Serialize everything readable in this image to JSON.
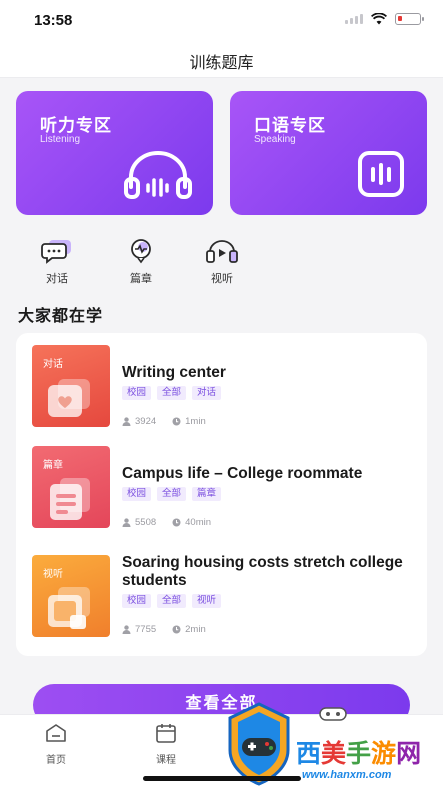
{
  "status_bar": {
    "time": "13:58"
  },
  "nav": {
    "title": "训练题库"
  },
  "zones": [
    {
      "title": "听力专区",
      "subtitle": "Listening",
      "icon": "headphones-icon"
    },
    {
      "title": "口语专区",
      "subtitle": "Speaking",
      "icon": "voice-wave-icon"
    }
  ],
  "quick_entries": [
    {
      "label": "对话",
      "icon": "dialogue-icon"
    },
    {
      "label": "篇章",
      "icon": "passage-icon"
    },
    {
      "label": "视听",
      "icon": "audiovisual-icon"
    }
  ],
  "section": {
    "title": "大家都在学"
  },
  "courses": [
    {
      "thumb_tag": "对话",
      "title": "Writing center",
      "tags": [
        "校园",
        "全部",
        "对话"
      ],
      "learners": "3924",
      "duration": "1min"
    },
    {
      "thumb_tag": "篇章",
      "title": "Campus life – College roommate",
      "tags": [
        "校园",
        "全部",
        "篇章"
      ],
      "learners": "5508",
      "duration": "40min"
    },
    {
      "thumb_tag": "视听",
      "title": "Soaring housing costs stretch college students",
      "tags": [
        "校园",
        "全部",
        "视听"
      ],
      "learners": "7755",
      "duration": "2min"
    }
  ],
  "view_all": {
    "label": "查看全部"
  },
  "tab_bar": {
    "items": [
      {
        "label": "首页",
        "icon": "home-icon"
      },
      {
        "label": "课程",
        "icon": "calendar-icon"
      }
    ]
  },
  "watermark": {
    "text": "西美手游网",
    "url": "www.hanxm.com"
  },
  "colors": {
    "accent": "#8b45f0",
    "card_red": "#ec5a45",
    "card_pink": "#ea5565",
    "card_orange": "#f6922f"
  }
}
